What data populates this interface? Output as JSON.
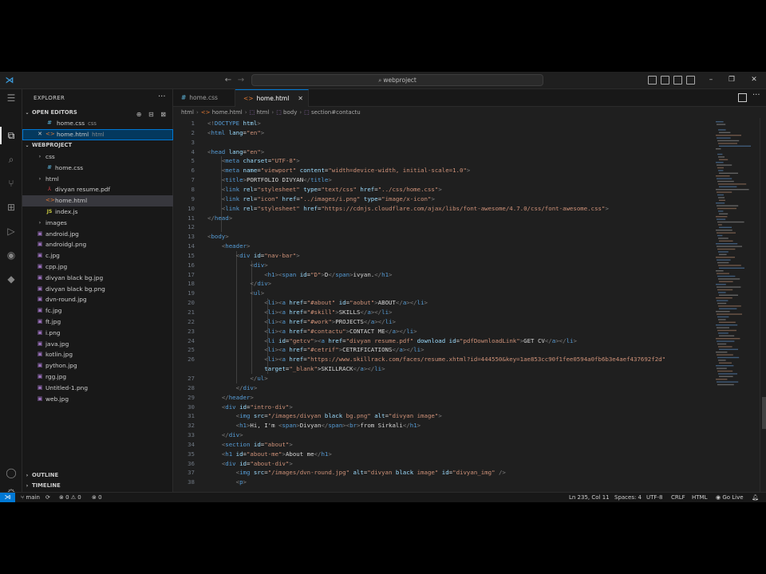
{
  "titlebar": {
    "logo_glyph": "⋊",
    "back_glyph": "←",
    "forward_glyph": "→",
    "search_icon": "⌕",
    "search_text": "webproject",
    "minimize_glyph": "–",
    "restore_glyph": "❐",
    "close_glyph": "✕"
  },
  "activity": {
    "menu_icon": "☰",
    "explorer_icon": "⧉",
    "search_icon": "⌕",
    "source_control_icon": "⑂",
    "extensions_icon": "⊞",
    "run_icon": "▷",
    "edge_icon": "◉",
    "android_icon": "◆",
    "account_icon": "◯",
    "settings_icon": "⚙"
  },
  "sidebar": {
    "title": "EXPLORER",
    "more": "···",
    "open_editors": {
      "label": "OPEN EDITORS",
      "actions": "⊕ ⊟ ⊠",
      "items": [
        {
          "icon": "#",
          "name": "home.css",
          "desc": "css",
          "close": ""
        },
        {
          "icon": "<>",
          "name": "home.html",
          "desc": "html",
          "close": "✕"
        }
      ]
    },
    "workspace": {
      "label": "WEBPROJECT",
      "tree": [
        {
          "icon": "›",
          "name": "css"
        },
        {
          "icon": "#",
          "name": "home.css"
        },
        {
          "icon": "›",
          "name": "html"
        },
        {
          "icon": "⅄",
          "name": "divyan resume.pdf"
        },
        {
          "icon": "<>",
          "name": "home.html"
        },
        {
          "icon": "JS",
          "name": "index.js"
        },
        {
          "icon": "›",
          "name": "images"
        },
        {
          "icon": "▣",
          "name": "android.jpg"
        },
        {
          "icon": "▣",
          "name": "androidgl.png"
        },
        {
          "icon": "▣",
          "name": "c.jpg"
        },
        {
          "icon": "▣",
          "name": "cpp.jpg"
        },
        {
          "icon": "▣",
          "name": "divyan black bg.jpg"
        },
        {
          "icon": "▣",
          "name": "divyan black bg.png"
        },
        {
          "icon": "▣",
          "name": "dvn-round.jpg"
        },
        {
          "icon": "▣",
          "name": "fc.jpg"
        },
        {
          "icon": "▣",
          "name": "ft.jpg"
        },
        {
          "icon": "▣",
          "name": "i.png"
        },
        {
          "icon": "▣",
          "name": "java.jpg"
        },
        {
          "icon": "▣",
          "name": "kotlin.jpg"
        },
        {
          "icon": "▣",
          "name": "python.jpg"
        },
        {
          "icon": "▣",
          "name": "rgg.jpg"
        },
        {
          "icon": "▣",
          "name": "Untitled-1.png"
        },
        {
          "icon": "▣",
          "name": "web.jpg"
        }
      ]
    },
    "outline": "OUTLINE",
    "timeline": "TIMELINE",
    "chev_right": "›",
    "chev_down": "⌄"
  },
  "tabs": [
    {
      "icon": "#",
      "label": "home.css"
    },
    {
      "icon": "<>",
      "label": "home.html",
      "close": "✕"
    }
  ],
  "tab_more": "···",
  "breadcrumb": [
    "html",
    "home.html",
    "html",
    "body",
    "section#contactu"
  ],
  "editor": {
    "lines": [
      {
        "n": "1",
        "c": "<!DOCTYPE html>"
      },
      {
        "n": "2",
        "c": "<html lang=\"en\">"
      },
      {
        "n": "3",
        "c": ""
      },
      {
        "n": "4",
        "c": "<head lang=\"en\">"
      },
      {
        "n": "5",
        "c": "    <meta charset=\"UTF-8\">"
      },
      {
        "n": "6",
        "c": "    <meta name=\"viewport\" content=\"width=device-width, initial-scale=1.0\">"
      },
      {
        "n": "7",
        "c": "    <title>PORTFOLIO DIVYAN</title>"
      },
      {
        "n": "8",
        "c": "    <link rel=\"stylesheet\" type=\"text/css\" href=\"../css/home.css\">"
      },
      {
        "n": "9",
        "c": "    <link rel=\"icon\" href=\"../images/i.png\" type=\"image/x-icon\">"
      },
      {
        "n": "10",
        "c": "    <link rel=\"stylesheet\" href=\"https://cdnjs.cloudflare.com/ajax/libs/font-awesome/4.7.0/css/font-awesome.css\">"
      },
      {
        "n": "11",
        "c": "</head>"
      },
      {
        "n": "12",
        "c": ""
      },
      {
        "n": "13",
        "c": "<body>"
      },
      {
        "n": "14",
        "c": "    <header>"
      },
      {
        "n": "15",
        "c": "        <div id=\"nav-bar\">"
      },
      {
        "n": "16",
        "c": "            <div>"
      },
      {
        "n": "17",
        "c": "                <h1><span id=\"D\">D</span>ivyan.</h1>"
      },
      {
        "n": "18",
        "c": "            </div>"
      },
      {
        "n": "19",
        "c": "            <ul>"
      },
      {
        "n": "20",
        "c": "                <li><a href=\"#about\" id=\"aobut\">ABOUT</a></li>"
      },
      {
        "n": "21",
        "c": "                <li><a href=\"#skill\">SKILLS</a></li>"
      },
      {
        "n": "22",
        "c": "                <li><a href=\"#work\">PROJECTS</a></li>"
      },
      {
        "n": "23",
        "c": "                <li><a href=\"#contactu\">CONTACT ME</a></li>"
      },
      {
        "n": "24",
        "c": "                <li id=\"getcv\"><a href=\"divyan resume.pdf\" download id=\"pdfDownloadLink\">GET CV</a></li>"
      },
      {
        "n": "25",
        "c": "                <li><a href=\"#cetrif\">CETRIFICATIONS</a></li>"
      },
      {
        "n": "26",
        "c": "                <li><a href=\"https://www.skillrack.com/faces/resume.xhtml?id=444550&key=1ae853cc90f1fee0594a0fb6b3e4aef437692f2d\""
      },
      {
        "n": "",
        "c": "                target=\"_blank\">SKILLRACK</a></li>"
      },
      {
        "n": "27",
        "c": "            </ul>"
      },
      {
        "n": "28",
        "c": "        </div>"
      },
      {
        "n": "29",
        "c": "    </header>"
      },
      {
        "n": "30",
        "c": "    <div id=\"intro-div\">"
      },
      {
        "n": "31",
        "c": "        <img src=\"/images/divyan black bg.png\" alt=\"divyan image\">"
      },
      {
        "n": "32",
        "c": "        <h1>Hi, I'm <span>Divyan</span><br>from Sirkali</h1>"
      },
      {
        "n": "33",
        "c": "    </div>"
      },
      {
        "n": "34",
        "c": "    <section id=\"about\">"
      },
      {
        "n": "35",
        "c": "    <h1 id=\"about-me\">About me</h1>"
      },
      {
        "n": "36",
        "c": "    <div id=\"about-div\">"
      },
      {
        "n": "37",
        "c": "        <img src=\"/images/dvn-round.jpg\" alt=\"divyan black image\" id=\"divyan_img\" />"
      },
      {
        "n": "38",
        "c": "        <p>"
      }
    ]
  },
  "statusbar": {
    "remote": "⋊",
    "branch": "⑂ main",
    "sync": "⟳",
    "problems": "⊗ 0 ⚠ 0",
    "ports": "⊗ 0",
    "position": "Ln 235, Col 11",
    "spaces": "Spaces: 4",
    "encoding": "UTF-8",
    "eol": "CRLF",
    "language": "HTML",
    "golive": "◉ Go Live",
    "bell": "🔔︎"
  }
}
